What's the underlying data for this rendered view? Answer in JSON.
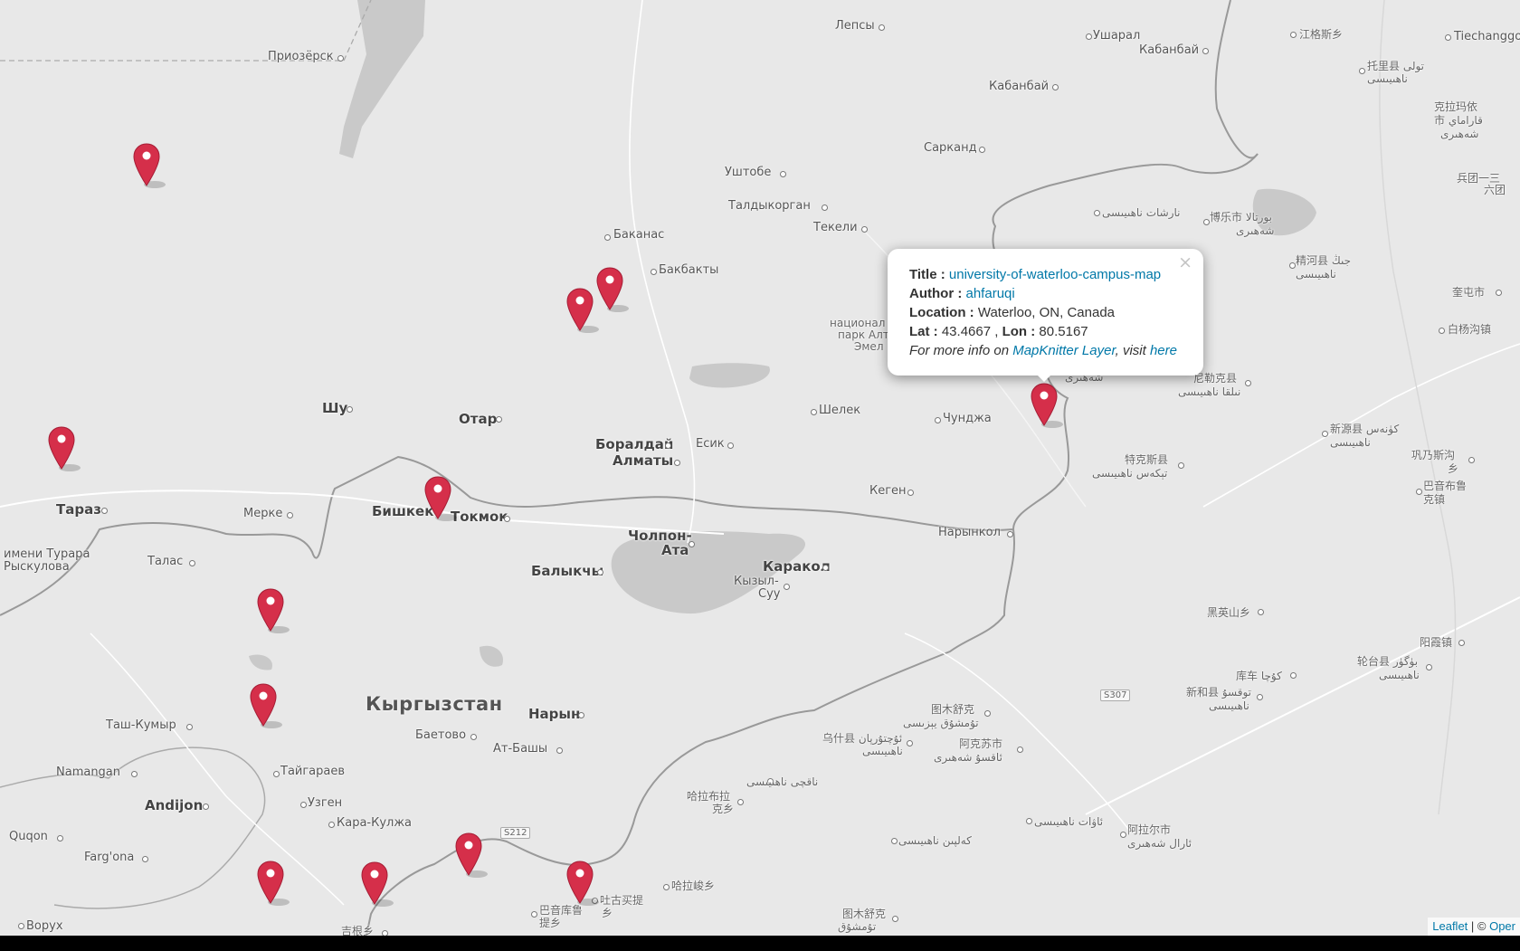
{
  "popup": {
    "title_label": "Title :",
    "title_value": "university-of-waterloo-campus-map",
    "author_label": "Author :",
    "author_value": "ahfaruqi",
    "location_label": "Location :",
    "location_value": "Waterloo, ON, Canada",
    "lat_label": "Lat :",
    "lat_value": "43.4667",
    "lat_sep": " , ",
    "lon_label": "Lon :",
    "lon_value": "80.5167",
    "more_prefix": "For more info on ",
    "more_link": "MapKnitter Layer",
    "more_mid": ", visit ",
    "more_here": "here",
    "close": "×"
  },
  "attribution": {
    "leaflet": "Leaflet",
    "sep": " | © ",
    "open": "Oper"
  },
  "labels": {
    "priozersk": "Приозёрск",
    "lepsy": "Лепсы",
    "ushzharal": "Ушарал",
    "kabanbay1": "Кабанбай",
    "kabanbay2": "Кабанбай",
    "jiangesi": "江格斯乡",
    "tiechanggou": "Tiechanggo",
    "tuolixian": "托里县 تولى",
    "tuolixian2": "ناھىيىسى",
    "kelamayi": "克拉玛依",
    "kelamayi2": "市 قاراماي",
    "kelamayi3": "شەھىرى",
    "bingtuan": "兵团一三",
    "bingtuan2": "六团",
    "sarkand": "Сарканд",
    "ushtobe": "Уштобе",
    "taldykorgan": "Талдыкорган",
    "tekeli": "Текели",
    "bakanas": "Баканас",
    "bakbakty": "Бакбакты",
    "narshat": "نارشات ناھىيىسى",
    "bole": "博乐市 بورتالا",
    "bole2": "شەھىرى",
    "jinghe": "精河县 جىڭ",
    "jinghe2": "ناھىيىسى",
    "kuitun": "奎屯市",
    "baiyang": "白杨沟镇",
    "park1": "национал",
    "park2": "парк Алт",
    "park3": "Эмел",
    "shahiri": "شەھىرى",
    "nileke": "尼勒克县",
    "nileke2": "نىلقا ناھىيىسى",
    "shu": "Шу",
    "otar": "Отар",
    "shelek": "Шелек",
    "chunja": "Чунджа",
    "boraldai": "Боралдай",
    "esik": "Есик",
    "almaty": "Алматы",
    "xinyuan": "新源县 كۈنەس",
    "xinyuan2": "ناھىيىسى",
    "gongnaisi": "巩乃斯沟",
    "gongnaisi2": "乡",
    "tekes": "特克斯县",
    "tekes2": "تېكەس ناھىيىسى",
    "bayinbuluke": "巴音布鲁",
    "bayinbuluke2": "克镇",
    "taraz": "Тараз",
    "merke": "Мерке",
    "bishkek": "Бишкек",
    "tokmok": "Токмок",
    "kegen": "Кеген",
    "narynkol": "Нарынкол",
    "turar1": "имени Турара",
    "turar2": "Рыскулова",
    "talas": "Талас",
    "cholpon1": "Чолпон-",
    "cholpon2": "Ата",
    "karakol": "Каракол",
    "balykchy": "Балыкчы",
    "kyzylsuu1": "Кызыл-",
    "kyzylsuu2": "Суу",
    "heiyingshan": "黑英山乡",
    "yangxia": "阳霞镇",
    "luntai": "轮台县 بۈگۈر",
    "luntai2": "ناھىيىسى",
    "kuche": "库车 كۇچا",
    "xinhe": "新和县 توقسۇ",
    "xinhe2": "ناھىيىسى",
    "kyrgyzstan": "Кыргызстан",
    "naryn": "Нарын",
    "tashkumyr": "Таш-Кумыр",
    "baetovo": "Баетово",
    "atbashy": "Ат-Башы",
    "tumushuke": "图木舒克",
    "tumushuke2": "تۇمشۇق يېزىسى",
    "wushi": "乌什县 ئۇچتۇرپان",
    "wushi2": "ناھىيىسى",
    "akesu": "阿克苏市",
    "akesu2": "ئاقسۇ شەھىرى",
    "namangan": "Namangan",
    "taigaraev": "Тайгараев",
    "andijon": "Andijon",
    "uzgen": "Узген",
    "karakulja": "Кара-Кулжа",
    "naqichi": "ناقچى ناھىيىسى",
    "habubu": "哈拉布拉",
    "habubu2": "克乡",
    "awati": "ئاۋات ناھىيىسى",
    "alaer": "阿拉尔市",
    "alaer2": "ئارال شەھىرى",
    "quqon": "Quqon",
    "fargona": "Farg'ona",
    "kelpin": "كەلپىن ناھىيىسى",
    "halajun": "哈拉峻乡",
    "bayinku": "巴音库鲁",
    "bayinku2": "提乡",
    "tugumai": "吐古买提",
    "tugumai2": "乡",
    "tumushuke3": "图木舒克",
    "tumushuke4": "تۇمشۇق",
    "vorukh": "Ворух",
    "jiliyu": "吉根乡",
    "s307": "S307",
    "s212": "S212"
  }
}
